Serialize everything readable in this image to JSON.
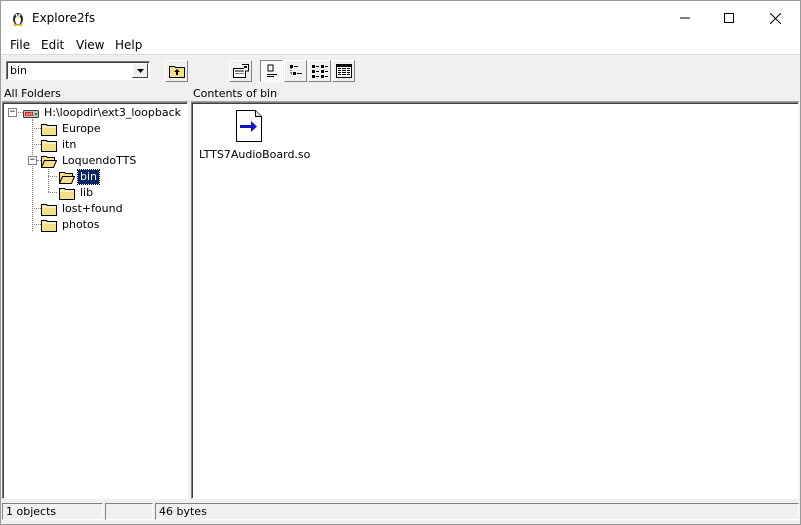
{
  "window": {
    "title": "Explore2fs"
  },
  "menu": {
    "items": [
      "File",
      "Edit",
      "View",
      "Help"
    ]
  },
  "toolbar": {
    "path_value": "bin",
    "buttons": [
      "up-folder-icon",
      "properties-icon",
      "large-icons-view-icon",
      "small-icons-view-icon",
      "list-view-icon",
      "details-view-icon"
    ]
  },
  "tree": {
    "header": "All Folders",
    "root": "H:\\loopdir\\ext3_loopback",
    "items": [
      {
        "label": "Europe"
      },
      {
        "label": "itn"
      },
      {
        "label": "LoquendoTTS"
      },
      {
        "label": "bin",
        "selected": true
      },
      {
        "label": "lib"
      },
      {
        "label": "lost+found"
      },
      {
        "label": "photos"
      }
    ]
  },
  "contents": {
    "header": "Contents of bin",
    "files": [
      {
        "name": "LTTS7AudioBoard.so",
        "icon": "symlink-file-icon"
      }
    ]
  },
  "status": {
    "objects": "1 objects",
    "middle": "",
    "size": "46 bytes"
  },
  "colors": {
    "selection": "#0a246a",
    "folder": "#f5e08a",
    "drive_red": "#d42020"
  }
}
